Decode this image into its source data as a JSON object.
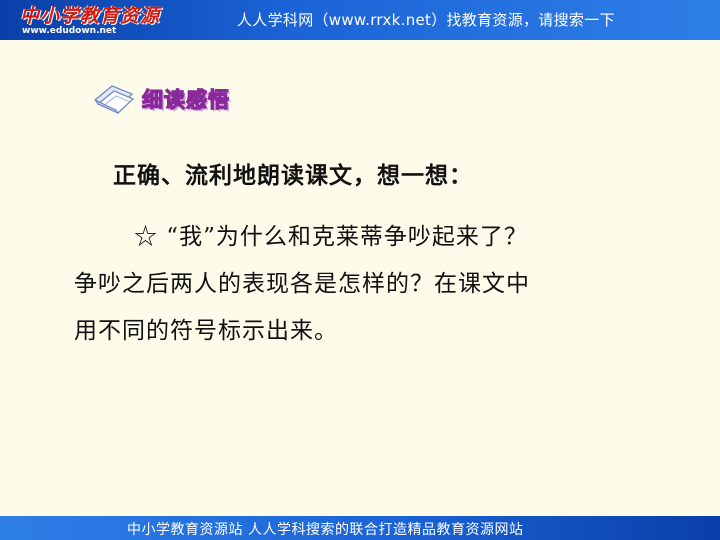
{
  "header": {
    "logo_text": "中小学教育资源",
    "logo_url": "www.edudown.net",
    "banner_text": "人人学科网（www.rrxk.net）找教育资源，请搜索一下"
  },
  "section": {
    "icon": "book-pages-icon",
    "title": "细读感悟"
  },
  "content": {
    "prompt": "正确、流利地朗读课文，想一想：",
    "question_line1": "☆ “我”为什么和克莱蒂争吵起来了？",
    "question_line2": "争吵之后两人的表现各是怎样的？在课文中",
    "question_line3": "用不同的符号标示出来。"
  },
  "footer": {
    "text": "中小学教育资源站  人人学科搜索的联合打造精品教育资源网站"
  },
  "colors": {
    "banner_blue": "#1b63d6",
    "background": "#fdfbea",
    "title_purple": "#8a2a9a",
    "logo_red": "#d21a10"
  }
}
